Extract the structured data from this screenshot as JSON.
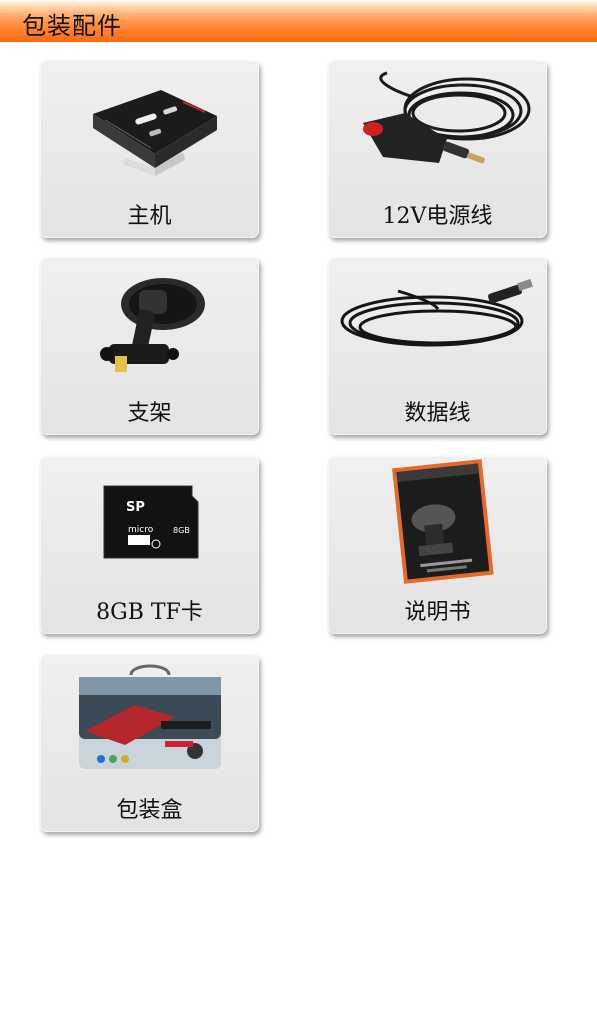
{
  "header": {
    "title": "包装配件"
  },
  "items": [
    {
      "label": "主机",
      "icon": "dashcam-device-icon"
    },
    {
      "label": "12V电源线",
      "icon": "car-charger-cable-icon"
    },
    {
      "label": "支架",
      "icon": "suction-mount-icon"
    },
    {
      "label": "数据线",
      "icon": "usb-cable-icon"
    },
    {
      "label": "8GB TF卡",
      "icon": "microsd-card-icon"
    },
    {
      "label": "说明书",
      "icon": "manual-booklet-icon"
    },
    {
      "label": "包装盒",
      "icon": "tin-box-icon"
    }
  ],
  "card_texts": {
    "sd_brand": "SP",
    "sd_micro": "micro",
    "sd_capacity": "8GB"
  }
}
